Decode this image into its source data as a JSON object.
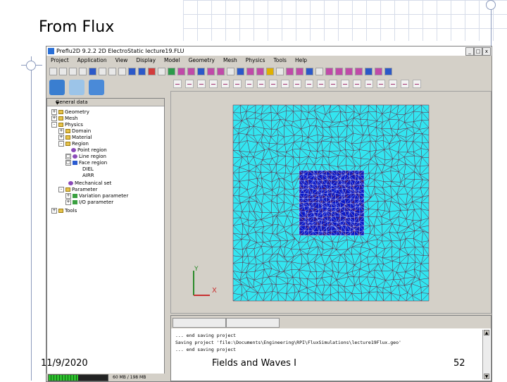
{
  "slide": {
    "title": "From Flux",
    "date": "11/9/2020",
    "footer": "Fields and Waves I",
    "page_number": "52"
  },
  "window": {
    "title": "Preflu2D 9.2.2  2D ElectroStatic  lecture19.FLU",
    "min": "_",
    "max": "□",
    "close": "x"
  },
  "menu": [
    "Project",
    "Application",
    "View",
    "Display",
    "Model",
    "Geometry",
    "Mesh",
    "Physics",
    "Tools",
    "Help"
  ],
  "tree": {
    "header": "General data",
    "items": [
      {
        "label": "Geometry",
        "expander": "+",
        "icon": "folder-icon"
      },
      {
        "label": "Mesh",
        "expander": "+",
        "icon": "folder-icon"
      },
      {
        "label": "Physics",
        "expander": "-",
        "icon": "folder-icon"
      },
      {
        "label": "Domain",
        "expander": "+",
        "icon": "folder-icon"
      },
      {
        "label": "Material",
        "expander": "+",
        "icon": "folder-icon"
      },
      {
        "label": "Region",
        "expander": "-",
        "icon": "folder-icon"
      },
      {
        "label": "Point region",
        "expander": "",
        "icon": "point-region-icon"
      },
      {
        "label": "Line region",
        "expander": "□",
        "icon": "line-region-icon"
      },
      {
        "label": "Face region",
        "expander": "□",
        "icon": "face-region-icon"
      },
      {
        "label": "DIEL",
        "expander": "",
        "icon": ""
      },
      {
        "label": "AIRR",
        "expander": "",
        "icon": ""
      },
      {
        "label": "Mechanical set",
        "expander": "",
        "icon": "mechanical-set-icon"
      },
      {
        "label": "Parameter",
        "expander": "-",
        "icon": "folder-icon"
      },
      {
        "label": "Variation parameter",
        "expander": "+",
        "icon": "variation-parameter-icon"
      },
      {
        "label": "I/O parameter",
        "expander": "+",
        "icon": "io-parameter-icon"
      },
      {
        "label": "Tools",
        "expander": "+",
        "icon": "folder-icon"
      }
    ]
  },
  "status": {
    "progress": 0.5,
    "memory": "60 MB / 198 MB"
  },
  "axes": {
    "x": "X",
    "y": "Y"
  },
  "console": {
    "lines": [
      "... end saving project",
      "Saving project 'file:\\Documents\\Engineering\\RPI\\FluxSimulations\\lecture19Flux.geo'",
      "... end saving project"
    ]
  },
  "colors": {
    "outer_region": "#33e5f0",
    "inner_region": "#0a1ac8",
    "mesh_lines": "#6b1e3a",
    "axis_y": "#2a8a2a",
    "axis_x": "#c83030"
  }
}
